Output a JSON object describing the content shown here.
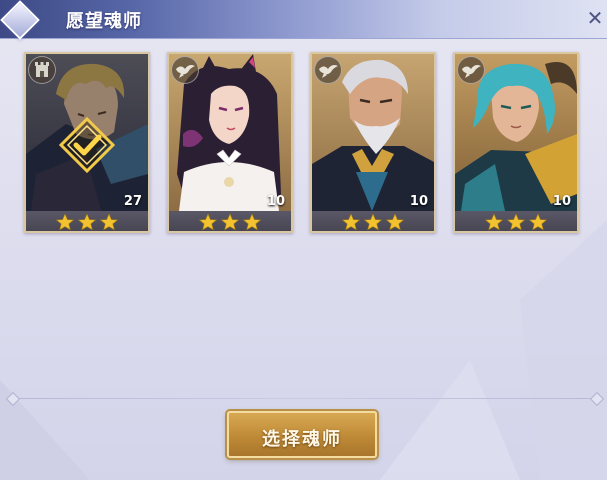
{
  "window": {
    "title": "愿望魂师",
    "close_symbol": "✕"
  },
  "cards": [
    {
      "stars": 3,
      "level": "27",
      "selected": true,
      "element_icon": "tower-icon"
    },
    {
      "stars": 3,
      "level": "10",
      "selected": false,
      "element_icon": "bird-icon"
    },
    {
      "stars": 3,
      "level": "10",
      "selected": false,
      "element_icon": "bird-icon"
    },
    {
      "stars": 3,
      "level": "10",
      "selected": false,
      "element_icon": "bird-icon"
    }
  ],
  "actions": {
    "select_label": "选择魂师"
  },
  "colors": {
    "star": "#f2c230",
    "accent_gold": "#c8973f",
    "title_bar": "#4a5694"
  }
}
